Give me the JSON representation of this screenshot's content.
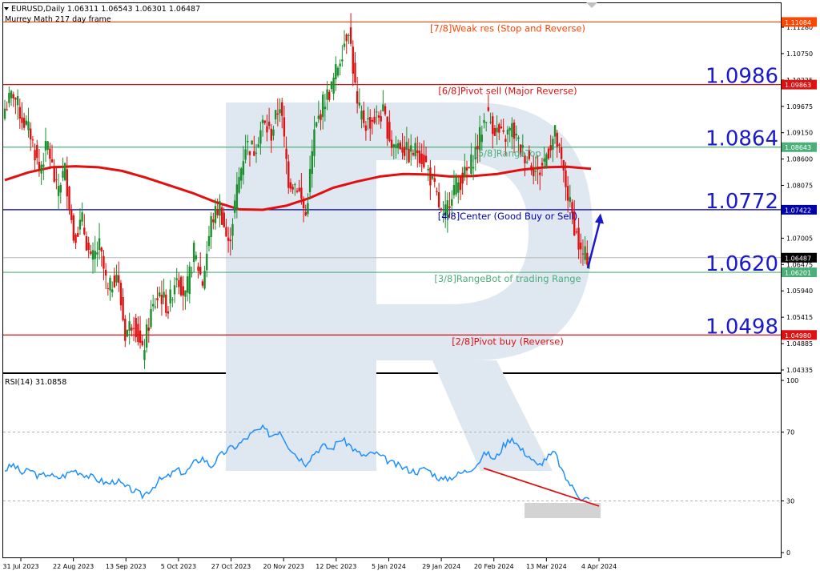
{
  "header": {
    "symbol_line": "EURUSD,Daily  1.06311 1.06543 1.06301 1.06487",
    "indicator_line": "Murrey Math 217 day frame"
  },
  "rsi_panel": {
    "label": "RSI(14) 31.0858",
    "levels": [
      100,
      70,
      30,
      0
    ],
    "level_labels": [
      "100",
      "70",
      "30",
      "0"
    ]
  },
  "chart_data": [
    {
      "type": "candlestick",
      "ylim": [
        1.0425,
        1.1145
      ],
      "price_axis_ticks": [
        "1.11280",
        "1.10750",
        "1.10225",
        "1.09675",
        "1.09150",
        "1.08600",
        "1.08075",
        "1.07530",
        "1.07005",
        "1.06475",
        "1.05940",
        "1.05415",
        "1.04885",
        "1.04335"
      ],
      "x_ticks": [
        "31 Jul 2023",
        "22 Aug 2023",
        "13 Sep 2023",
        "5 Oct 2023",
        "27 Oct 2023",
        "20 Nov 2023",
        "12 Dec 2023",
        "5 Jan 2024",
        "29 Jan 2024",
        "20 Feb 2024",
        "13 Mar 2024",
        "4 Apr 2024"
      ],
      "levels": [
        {
          "name": "[7/8]Weak res (Stop and Reverse)",
          "value": 1.11084,
          "tag": "1.11084",
          "color": "#ff4500"
        },
        {
          "name": "[6/8]Pivot sell (Major Reverse)",
          "value": 1.09863,
          "tag": "1.09863",
          "big": "1.0986",
          "color": "#dd1111"
        },
        {
          "name": "[5/8]RangeTop",
          "value": 1.08643,
          "tag": "1.08643",
          "big": "1.0864",
          "color": "#4caf7a"
        },
        {
          "name": "[4/8]Center (Good Buy or Sell)",
          "value": 1.07422,
          "tag": "1.07422",
          "big": "1.0772",
          "color": "#0000aa"
        },
        {
          "name": "[3/8]RangeBot of trading Range",
          "value": 1.06201,
          "tag": "1.06201",
          "big": "1.0620",
          "color": "#4caf7a"
        },
        {
          "name": "[2/8]Pivot buy (Reverse)",
          "value": 1.0498,
          "tag": "1.04980",
          "big": "1.0498",
          "color": "#dd1111"
        }
      ],
      "current_price": {
        "value": 1.06487,
        "tag": "1.06487"
      },
      "price_path": [
        1.094,
        1.097,
        1.092,
        1.089,
        1.082,
        1.087,
        1.078,
        1.082,
        1.069,
        1.072,
        1.064,
        1.067,
        1.058,
        1.062,
        1.05,
        1.053,
        1.046,
        1.054,
        1.058,
        1.055,
        1.062,
        1.057,
        1.066,
        1.06,
        1.072,
        1.075,
        1.067,
        1.078,
        1.087,
        1.086,
        1.091,
        1.089,
        1.095,
        1.08,
        1.079,
        1.073,
        1.089,
        1.095,
        1.098,
        1.104,
        1.11,
        1.094,
        1.091,
        1.092,
        1.093,
        1.087,
        1.087,
        1.085,
        1.086,
        1.083,
        1.078,
        1.072,
        1.078,
        1.08,
        1.082,
        1.087,
        1.093,
        1.09,
        1.088,
        1.09,
        1.086,
        1.084,
        1.081,
        1.085,
        1.089,
        1.081,
        1.073,
        1.0655,
        1.0649
      ],
      "moving_average": [
        1.08,
        1.0815,
        1.0825,
        1.0827,
        1.0825,
        1.0818,
        1.0805,
        1.079,
        1.0775,
        1.0757,
        1.0743,
        1.0742,
        1.075,
        1.0765,
        1.0785,
        1.0797,
        1.0807,
        1.0812,
        1.0811,
        1.0807,
        1.0808,
        1.0812,
        1.082,
        1.0825,
        1.0826,
        1.0822
      ],
      "projection_arrow": "up"
    },
    {
      "type": "line",
      "title": "RSI(14) 31.0858",
      "ylim": [
        0,
        100
      ],
      "values": [
        48,
        51,
        46,
        48,
        44,
        46,
        43,
        45,
        48,
        46,
        44,
        42,
        40,
        42,
        38,
        36,
        33,
        37,
        42,
        44,
        48,
        46,
        52,
        55,
        50,
        56,
        60,
        62,
        66,
        70,
        72,
        68,
        71,
        62,
        56,
        52,
        58,
        62,
        60,
        66,
        63,
        58,
        56,
        58,
        55,
        52,
        50,
        48,
        47,
        49,
        45,
        42,
        44,
        46,
        48,
        52,
        58,
        54,
        62,
        67,
        60,
        56,
        50,
        55,
        58,
        45,
        38,
        32,
        31.0858
      ],
      "trendline": "falling"
    }
  ]
}
